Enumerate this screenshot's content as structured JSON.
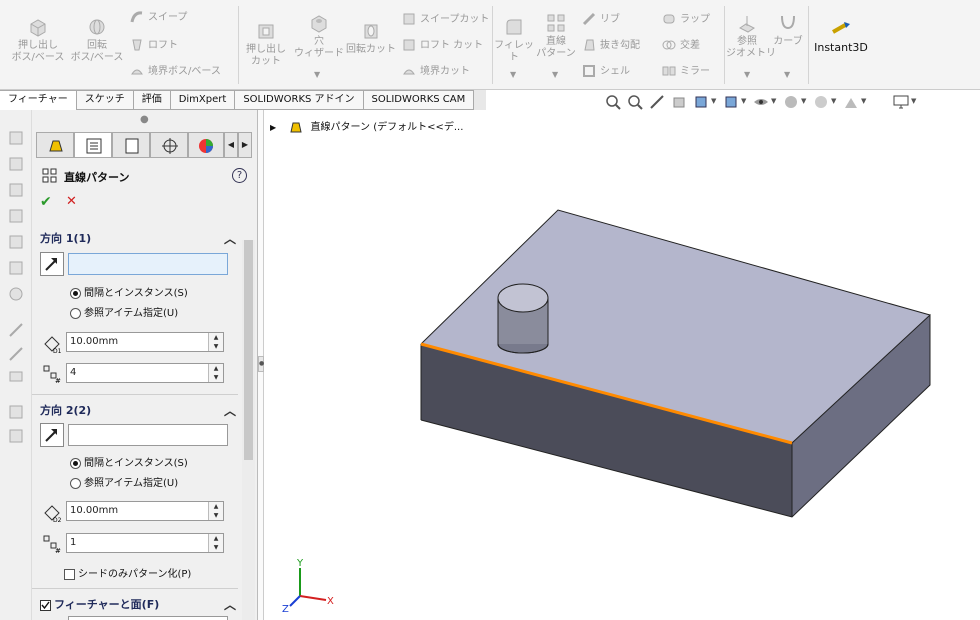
{
  "ribbon": {
    "extrude_boss": "押し出し\nボス/ベース",
    "revolve_boss": "回転\nボス/ベース",
    "sweep": "スイープ",
    "loft": "ロフト",
    "boundary_boss": "境界ボス/ベース",
    "extrude_cut": "押し出し\nカット",
    "hole_wizard": "穴\nウィザード",
    "revolve_cut": "回転カット",
    "swept_cut": "スイープカット",
    "loft_cut": "ロフト カット",
    "boundary_cut": "境界カット",
    "fillet": "フィレット",
    "linear_pattern": "直線\nパターン",
    "rib": "リブ",
    "draft": "抜き勾配",
    "shell": "シェル",
    "wrap": "ラップ",
    "intersect": "交差",
    "mirror": "ミラー",
    "ref_geometry": "参照\nジオメトリ",
    "curves": "カーブ",
    "instant3d": "Instant3D"
  },
  "tabs": [
    "フィーチャー",
    "スケッチ",
    "評価",
    "DimXpert",
    "SOLIDWORKS アドイン",
    "SOLIDWORKS CAM"
  ],
  "tree": {
    "item": "直線パターン (デフォルト<<デ..."
  },
  "pm": {
    "title": "直線パターン",
    "help": "?",
    "ok": "✔",
    "cancel": "✕",
    "dir1": {
      "header": "方向 1(1)",
      "radio_spacing": "間隔とインスタンス(S)",
      "radio_ref": "参照アイテム指定(U)",
      "spacing": "10.00mm",
      "instances": "4"
    },
    "dir2": {
      "header": "方向 2(2)",
      "radio_spacing": "間隔とインスタンス(S)",
      "radio_ref": "参照アイテム指定(U)",
      "spacing": "10.00mm",
      "instances": "1",
      "seed_only": "シードのみパターン化(P)"
    },
    "features": {
      "header": "フィーチャーと面(F)"
    }
  },
  "triad": {
    "x": "X",
    "y": "Y",
    "z": "Z"
  },
  "colors": {
    "top_face": "#b4b6cc",
    "front_face": "#4b4c59",
    "side_face": "#6c6e82",
    "edge_highlight": "#ff8a00",
    "accent_blue": "#2a5bb8"
  },
  "icons": [
    "extrude-icon",
    "revolve-icon",
    "sweep-icon",
    "loft-icon",
    "hole-icon",
    "fillet-icon",
    "pattern-icon",
    "rib-icon",
    "instant3d-icon",
    "zoom-icon",
    "view-orient-icon",
    "display-style-icon",
    "monitor-icon"
  ]
}
